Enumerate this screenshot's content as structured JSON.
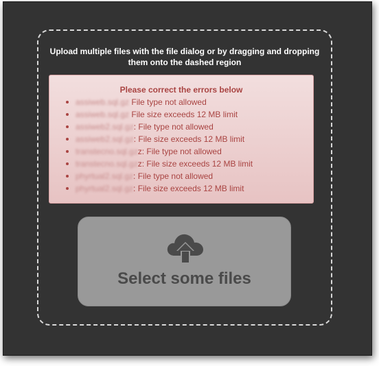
{
  "dropzone": {
    "instructions": "Upload multiple files with the file dialog or by dragging and dropping them onto the dashed region"
  },
  "errors": {
    "title": "Please correct the errors below",
    "items": [
      {
        "file": "assiweb.sql.gz",
        "message": " File type not allowed"
      },
      {
        "file": "assiweb.sql.gz",
        "message": " File size exceeds 12 MB limit"
      },
      {
        "file": "assiweb2.sql.gz",
        "message": ": File type not allowed"
      },
      {
        "file": "assiweb2.sql.gz",
        "message": ": File size exceeds 12 MB limit"
      },
      {
        "file": "transtecno.sql.gz",
        "message": "z: File type not allowed"
      },
      {
        "file": "transtecno.sql.gz",
        "message": "z: File size exceeds 12 MB limit"
      },
      {
        "file": "phyrtual2.sql.gz",
        "message": ": File type not allowed"
      },
      {
        "file": "phyrtual2.sql.gz",
        "message": ": File size exceeds 12 MB limit"
      }
    ]
  },
  "select_button": {
    "label": "Select some files",
    "icon": "cloud-upload-icon"
  },
  "colors": {
    "background": "#333333",
    "error_text": "#a94442",
    "error_bg": "#f2dede",
    "button_bg": "#999999",
    "button_text": "#4a4a4a"
  }
}
